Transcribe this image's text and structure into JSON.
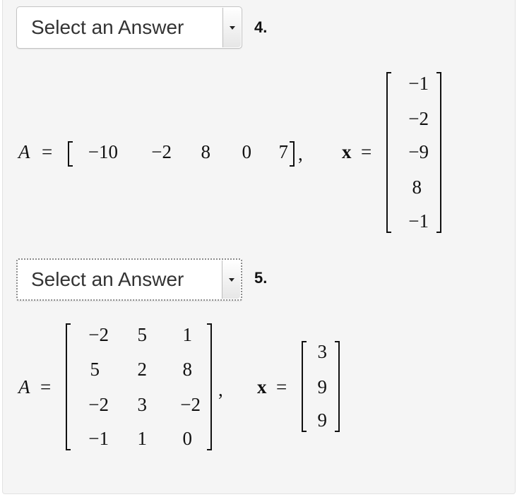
{
  "questions": [
    {
      "number": "4.",
      "select_label": "Select an Answer",
      "A_label": "A",
      "x_label": "x",
      "equals": "=",
      "comma": ",",
      "A_row": [
        "−10",
        "−2",
        "8",
        "0",
        "7"
      ],
      "x_col": [
        "−1",
        "−2",
        "−9",
        "8",
        "−1"
      ]
    },
    {
      "number": "5.",
      "select_label": "Select an Answer",
      "A_label": "A",
      "x_label": "x",
      "equals": "=",
      "comma": ",",
      "A_matrix": [
        [
          "−2",
          "5",
          "1"
        ],
        [
          "5",
          "2",
          "8"
        ],
        [
          "−2",
          "3",
          "−2"
        ],
        [
          "−1",
          "1",
          "0"
        ]
      ],
      "x_col": [
        "3",
        "9",
        "9"
      ]
    }
  ]
}
